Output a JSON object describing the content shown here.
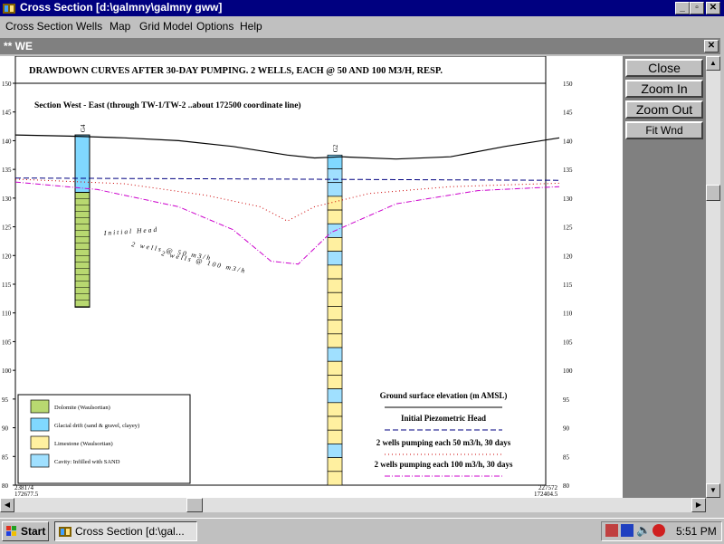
{
  "window": {
    "title": "Cross Section [d:\\galmny\\galmny gww]"
  },
  "menu": {
    "items": [
      "Cross Section",
      "Wells",
      "Map",
      "Grid Model",
      "Options",
      "Help"
    ]
  },
  "document": {
    "title": "** WE"
  },
  "chart_data": {
    "type": "cross-section",
    "title": "DRAWDOWN CURVES AFTER 30-DAY PUMPING. 2 WELLS, EACH @ 50 AND 100 M3/H, RESP.",
    "subtitle": "Section West - East (through TW-1/TW-2 ..about 172500 coordinate line)",
    "ylim": [
      80,
      150
    ],
    "yticks": [
      80,
      85,
      90,
      95,
      100,
      105,
      110,
      115,
      120,
      125,
      130,
      135,
      140,
      145,
      150
    ],
    "x_corner_labels": {
      "left": [
        "238174",
        "172677.5"
      ],
      "right": [
        "227572",
        "172404.5"
      ]
    },
    "wells": [
      {
        "name": "G4",
        "top": 141,
        "bottom": 111
      },
      {
        "name": "G2",
        "top": 137.5,
        "bottom": 80
      }
    ],
    "series": [
      {
        "name": "Ground surface elevation (m AMSL)",
        "style": "solid",
        "color": "#000000",
        "x": [
          0,
          0.1,
          0.2,
          0.3,
          0.4,
          0.5,
          0.55,
          0.6,
          0.7,
          0.8,
          0.9,
          1.0
        ],
        "y": [
          141,
          140.8,
          140.5,
          140,
          139,
          137.5,
          137,
          137.2,
          136.8,
          137.2,
          139,
          140.5
        ]
      },
      {
        "name": "Initial Piezometric Head",
        "style": "dashed",
        "color": "#000080",
        "x": [
          0,
          0.25,
          0.5,
          0.75,
          1.0
        ],
        "y": [
          133.5,
          133.4,
          133.3,
          133.2,
          133.1
        ]
      },
      {
        "name": "2 wells pumping each 50 m3/h, 30 days",
        "style": "dotted",
        "color": "#cc0000",
        "x": [
          0,
          0.2,
          0.35,
          0.45,
          0.5,
          0.55,
          0.65,
          0.8,
          1.0
        ],
        "y": [
          133.3,
          132.5,
          130.5,
          128.5,
          126,
          128.5,
          130.8,
          132,
          132.6
        ]
      },
      {
        "name": "2 wells pumping each 100 m3/h, 30 days",
        "style": "dashdot",
        "color": "#cc00cc",
        "x": [
          0,
          0.15,
          0.3,
          0.4,
          0.47,
          0.52,
          0.58,
          0.7,
          0.85,
          1.0
        ],
        "y": [
          132.8,
          131.5,
          128.5,
          124.5,
          119,
          118.5,
          124,
          129,
          131.3,
          132
        ]
      }
    ],
    "curve_labels": [
      "Initial Head",
      "2 wells @ 50 m3/h",
      "2 wells @ 100 m3/h"
    ],
    "lithology_legend": [
      {
        "label": "Dolomite (Waulsortian)",
        "color": "#b8d870"
      },
      {
        "label": "Glacial drift (sand & gravel, clayey)",
        "color": "#80d8ff"
      },
      {
        "label": "Limestone (Waulsortian)",
        "color": "#fff0a0"
      },
      {
        "label": "Cavity: Infilled with SAND",
        "color": "#a0e0ff"
      }
    ]
  },
  "side_buttons": {
    "close": "Close",
    "zoom_in": "Zoom In",
    "zoom_out": "Zoom Out",
    "fit": "Fit Wnd"
  },
  "taskbar": {
    "start": "Start",
    "task": "Cross Section [d:\\gal...",
    "clock": "5:51 PM"
  },
  "colors": {
    "titlebar": "#000080",
    "panel": "#808080",
    "face": "#c0c0c0"
  }
}
